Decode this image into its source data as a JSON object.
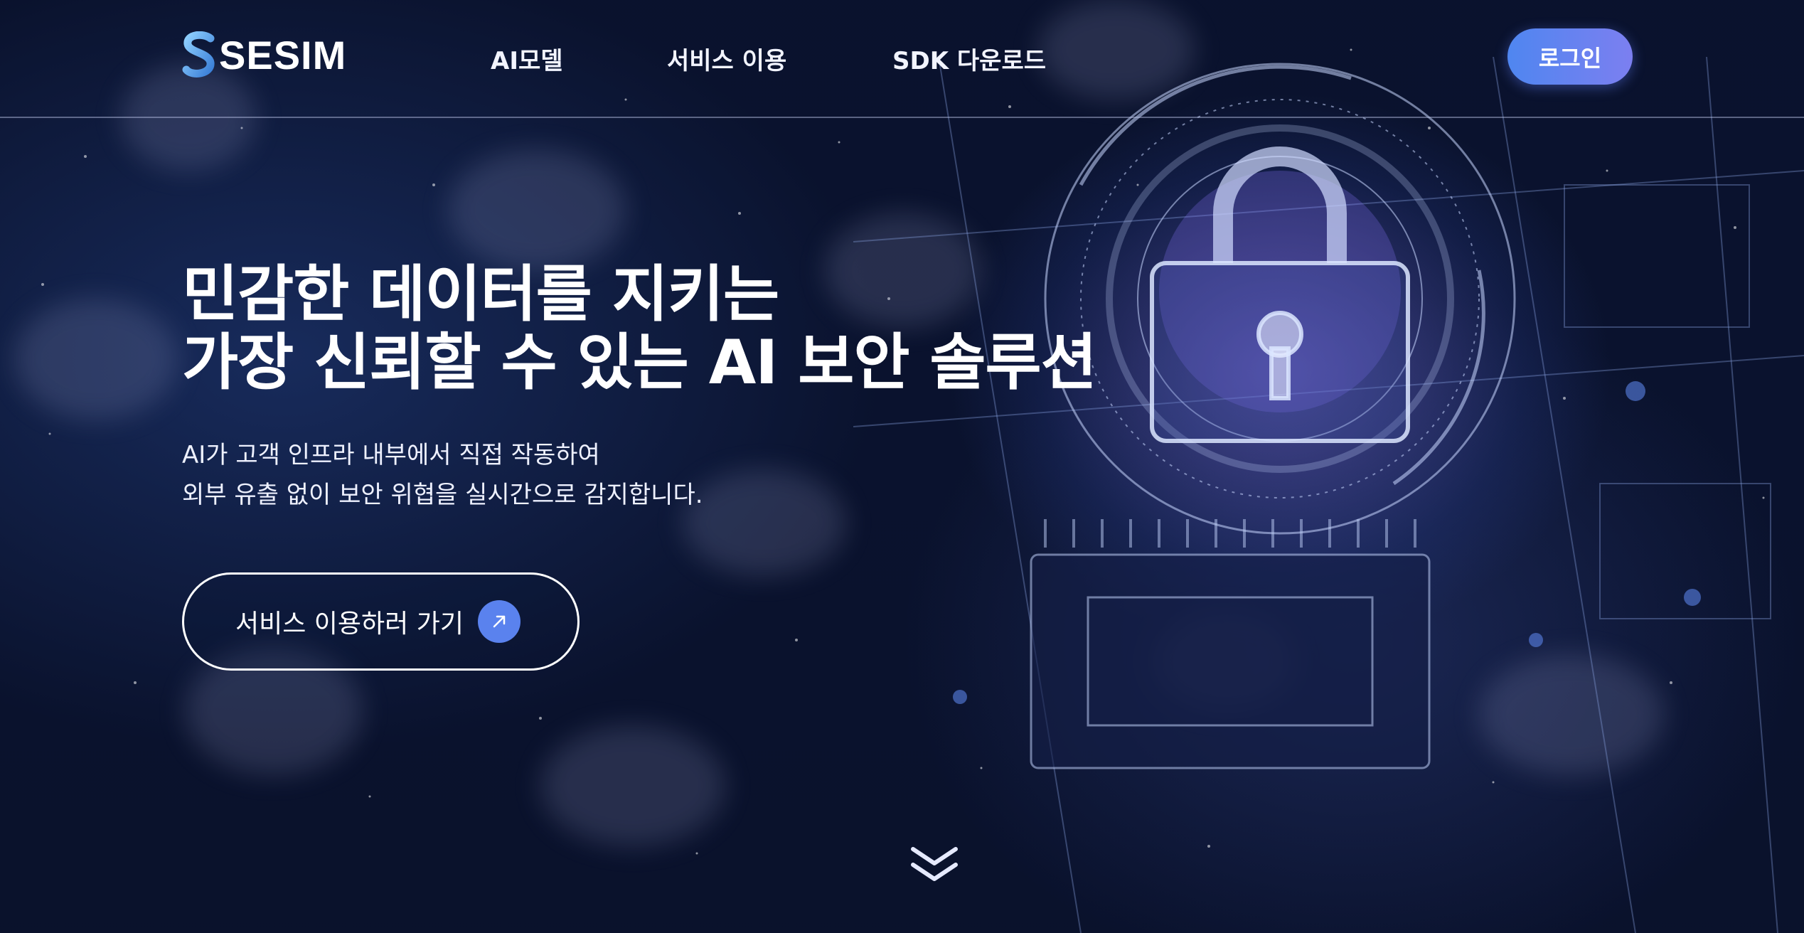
{
  "brand": {
    "name": "SESIM"
  },
  "nav": {
    "items": [
      {
        "label": "AI모델"
      },
      {
        "label": "서비스 이용"
      },
      {
        "label": "SDK 다운로드"
      }
    ],
    "login_label": "로그인"
  },
  "hero": {
    "title_line1": "민감한 데이터를 지키는",
    "title_line2": "가장 신뢰할 수 있는 AI 보안 솔루션",
    "subtitle_line1": "AI가 고객 인프라 내부에서 직접 작동하여",
    "subtitle_line2": "외부 유출 없이 보안 위협을 실시간으로 감지합니다.",
    "cta_label": "서비스 이용하러 가기"
  },
  "icons": {
    "logo": "s-logo-icon",
    "cta": "arrow-up-right-icon",
    "scroll": "chevron-double-down-icon",
    "hero_art": "padlock-circuit-icon"
  },
  "colors": {
    "background": "#0b1330",
    "accent": "#5a82ee",
    "login_gradient_start": "#4f86f0",
    "login_gradient_end": "#7c7ff0"
  }
}
